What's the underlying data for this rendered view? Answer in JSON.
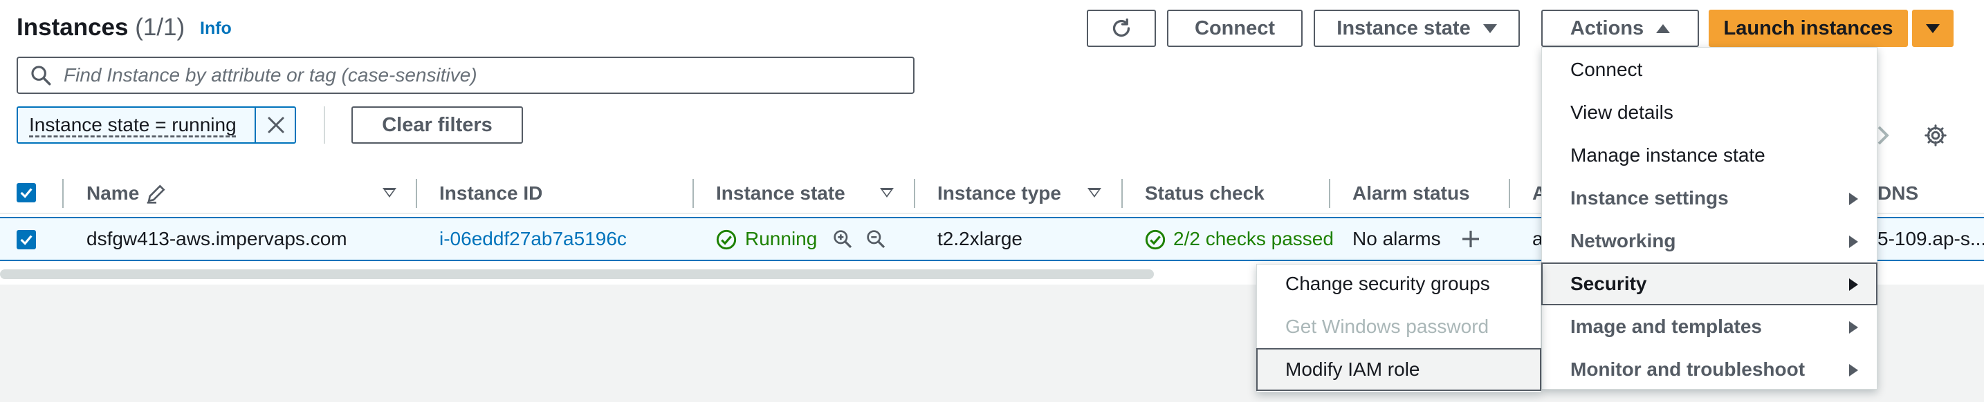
{
  "header": {
    "title": "Instances",
    "count": "(1/1)",
    "info_label": "Info"
  },
  "toolbar": {
    "refresh_icon": "refresh-icon",
    "connect_label": "Connect",
    "instance_state_label": "Instance state",
    "actions_label": "Actions",
    "launch_label": "Launch instances"
  },
  "search": {
    "placeholder": "Find Instance by attribute or tag (case-sensitive)"
  },
  "filter": {
    "token_label": "Instance state = running",
    "clear_label": "Clear filters"
  },
  "table": {
    "columns": [
      "Name",
      "Instance ID",
      "Instance state",
      "Instance type",
      "Status check",
      "Alarm status",
      "A",
      "DNS"
    ],
    "rows": [
      {
        "name": "dsfgw413-aws.impervaps.com",
        "instance_id": "i-06eddf27ab7a5196c",
        "instance_state": "Running",
        "instance_type": "t2.2xlarge",
        "status_check": "2/2 checks passed",
        "alarm_status": "No alarms",
        "az_fragment": "a",
        "dns_fragment": "5-109.ap-s..."
      }
    ]
  },
  "actions_menu": {
    "items": [
      {
        "label": "Connect"
      },
      {
        "label": "View details"
      },
      {
        "label": "Manage instance state"
      },
      {
        "label": "Instance settings"
      },
      {
        "label": "Networking"
      },
      {
        "label": "Security"
      },
      {
        "label": "Image and templates"
      },
      {
        "label": "Monitor and troubleshoot"
      }
    ]
  },
  "security_submenu": {
    "items": [
      {
        "label": "Change security groups",
        "enabled": true
      },
      {
        "label": "Get Windows password",
        "enabled": false
      },
      {
        "label": "Modify IAM role",
        "enabled": true
      }
    ]
  },
  "colors": {
    "accent": "#0073bb",
    "primary_button": "#f4a132",
    "success": "#1d8102"
  }
}
